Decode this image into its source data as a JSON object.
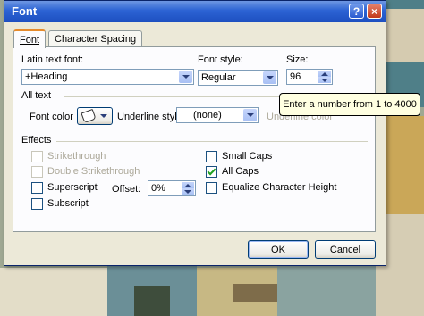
{
  "dialog": {
    "title": "Font",
    "help_glyph": "?",
    "close_glyph": "×"
  },
  "tabs": [
    {
      "label": "Font",
      "active": true
    },
    {
      "label": "Character Spacing",
      "active": false
    }
  ],
  "latin_font": {
    "label": "Latin text font:",
    "value": "+Heading"
  },
  "font_style": {
    "label": "Font style:",
    "value": "Regular"
  },
  "size": {
    "label": "Size:",
    "value": "96"
  },
  "tooltip": "Enter a number from 1 to 4000",
  "all_text": {
    "section_label": "All text",
    "font_color_label": "Font color",
    "underline_style_label": "Underline style",
    "underline_style_value": "(none)",
    "underline_color_label": "Underline color"
  },
  "effects": {
    "section_label": "Effects",
    "strikethrough": "Strikethrough",
    "double_strikethrough": "Double Strikethrough",
    "superscript": "Superscript",
    "subscript": "Subscript",
    "offset_label": "Offset:",
    "offset_value": "0%",
    "small_caps": "Small Caps",
    "all_caps": "All Caps",
    "equalize": "Equalize Character Height"
  },
  "buttons": {
    "ok": "OK",
    "cancel": "Cancel"
  },
  "colors": {
    "titlebar": "#2c63d4",
    "dialog_bg": "#ece9d8",
    "tooltip_bg": "#ffffe1"
  }
}
